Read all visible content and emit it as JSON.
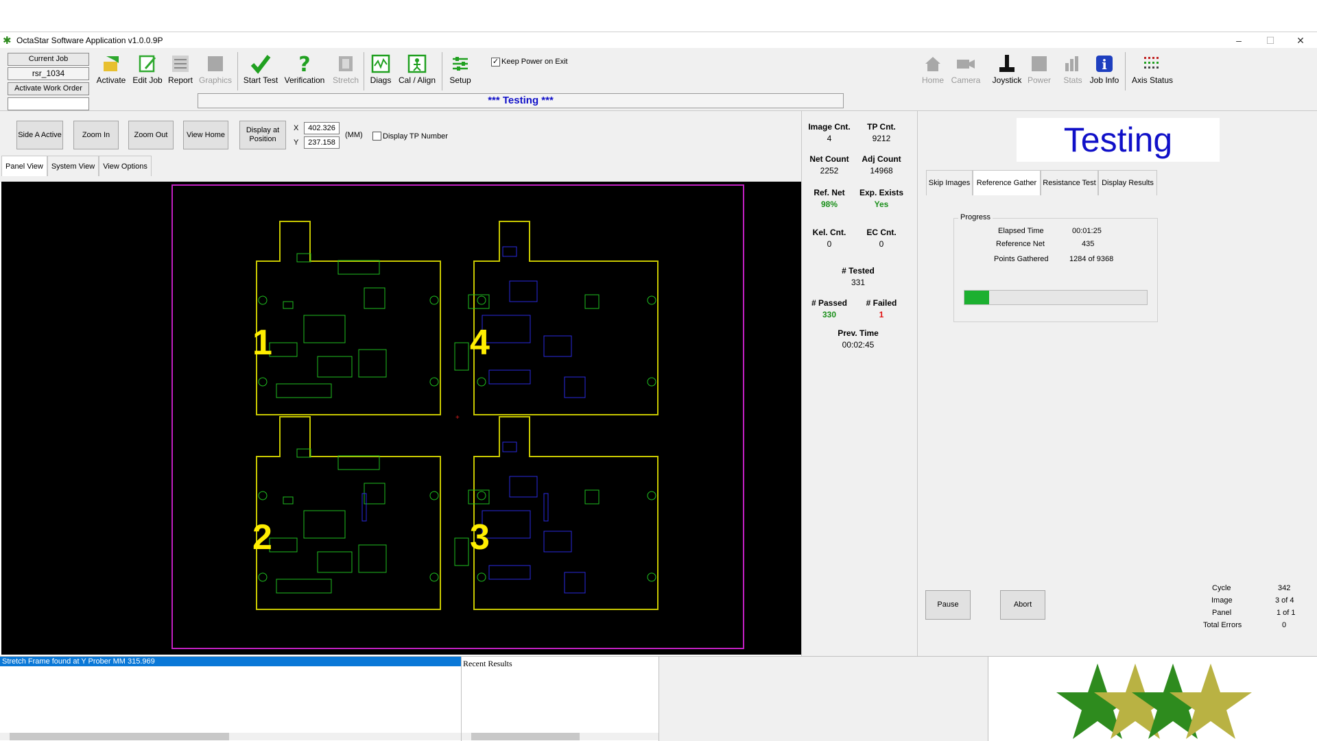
{
  "window": {
    "title": "OctaStar Software Application v1.0.0.9P",
    "minimize": "–",
    "maximize": "☐",
    "close": "✕"
  },
  "job": {
    "current_job_label": "Current Job",
    "job_name": "rsr_1034",
    "activate_work_order_label": "Activate Work Order",
    "work_order_value": ""
  },
  "toolbar": {
    "activate": "Activate",
    "edit_job": "Edit Job",
    "report": "Report",
    "graphics": "Graphics",
    "start_test": "Start Test",
    "verification": "Verification",
    "stretch": "Stretch",
    "diags": "Diags",
    "cal_align": "Cal / Align",
    "setup": "Setup",
    "keep_power_label": "Keep Power on Exit",
    "keep_power_checked": true,
    "home": "Home",
    "camera": "Camera",
    "joystick": "Joystick",
    "power": "Power",
    "stats": "Stats",
    "job_info": "Job Info",
    "axis_status": "Axis Status"
  },
  "status": {
    "banner": "*** Testing ***"
  },
  "view_controls": {
    "side_a_active": "Side A Active",
    "zoom_in": "Zoom In",
    "zoom_out": "Zoom Out",
    "view_home": "View Home",
    "display_at_position_line1": "Display at",
    "display_at_position_line2": "Position",
    "x_label": "X",
    "y_label": "Y",
    "x_value": "402.326",
    "y_value": "237.158",
    "units": "(MM)",
    "display_tp_number": "Display TP Number"
  },
  "view_tabs": [
    "Panel View",
    "System View",
    "View Options"
  ],
  "panel": {
    "board_numbers": [
      "1",
      "4",
      "2",
      "3"
    ]
  },
  "stats": {
    "image_cnt_label": "Image Cnt.",
    "image_cnt": "4",
    "tp_cnt_label": "TP  Cnt.",
    "tp_cnt": "9212",
    "net_count_label": "Net Count",
    "net_count": "2252",
    "adj_count_label": "Adj Count",
    "adj_count": "14968",
    "ref_net_label": "Ref. Net",
    "ref_net": "98%",
    "exp_exists_label": "Exp. Exists",
    "exp_exists": "Yes",
    "kel_cnt_label": "Kel. Cnt.",
    "kel_cnt": "0",
    "ec_cnt_label": "EC Cnt.",
    "ec_cnt": "0",
    "tested_label": "# Tested",
    "tested": "331",
    "passed_label": "# Passed",
    "passed": "330",
    "failed_label": "# Failed",
    "failed": "1",
    "prev_time_label": "Prev. Time",
    "prev_time": "00:02:45"
  },
  "right": {
    "big_status": "Testing",
    "tabs": [
      "Skip Images",
      "Reference Gather",
      "Resistance Test",
      "Display Results"
    ],
    "progress_group_label": "Progress",
    "elapsed_time_label": "Elapsed Time",
    "elapsed_time": "00:01:25",
    "reference_net_label": "Reference Net",
    "reference_net": "435",
    "points_gathered_label": "Points Gathered",
    "points_gathered": "1284 of 9368",
    "progress_fraction": 0.137,
    "pause": "Pause",
    "abort": "Abort",
    "cycle_label": "Cycle",
    "cycle": "342",
    "image_label": "Image",
    "image": "3 of 4",
    "panel_label": "Panel",
    "panel": "1 of 1",
    "total_errors_label": "Total Errors",
    "total_errors": "0"
  },
  "bottom": {
    "log_selected": "Stretch Frame found at Y Prober MM 315.969",
    "recent_results_label": "Recent Results"
  },
  "colors": {
    "accent_blue": "#1010c8",
    "pass_green": "#1a8f1a",
    "fail_red": "#e01010",
    "progress_green": "#1cb030",
    "board_outline": "#c8c800",
    "panel_outline": "#c220c2"
  }
}
